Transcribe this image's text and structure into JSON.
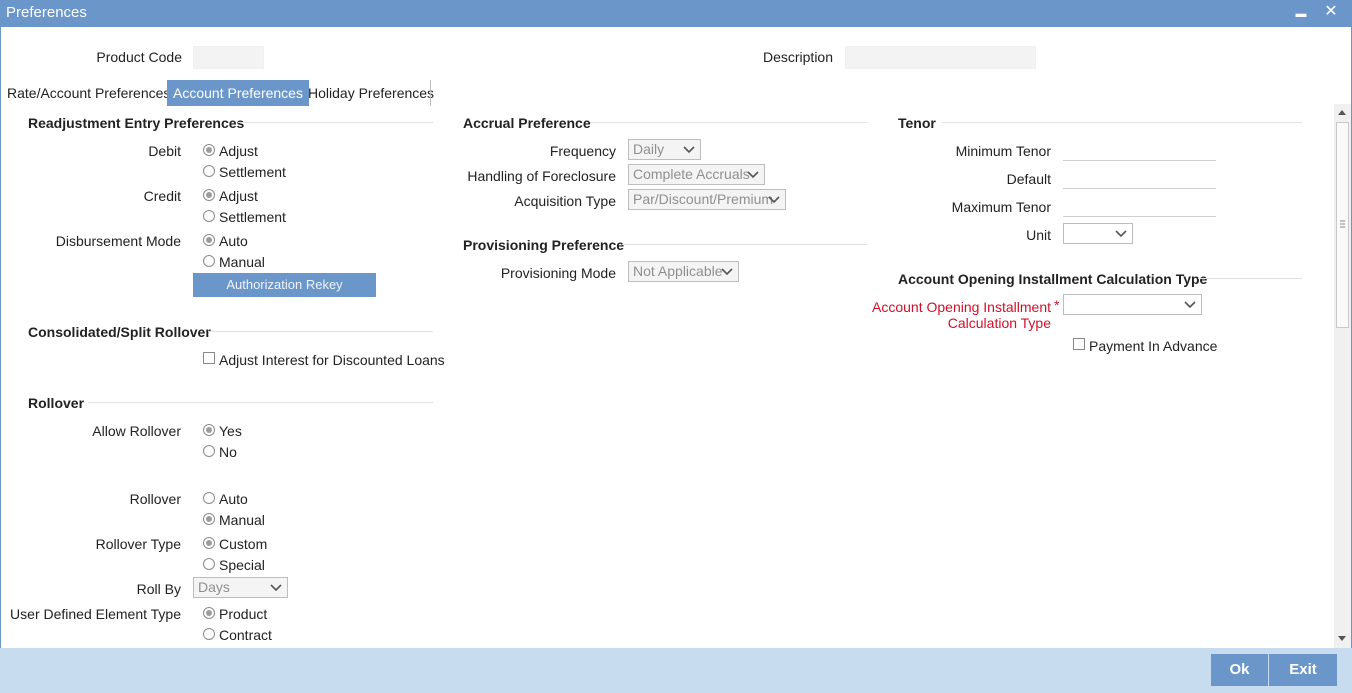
{
  "window": {
    "title": "Preferences",
    "minimize": "▬",
    "close": "✕"
  },
  "header": {
    "product_code_label": "Product Code",
    "description_label": "Description"
  },
  "tabs": [
    {
      "label": "Rate/Account Preferences",
      "active": false
    },
    {
      "label": "Account Preferences",
      "active": true
    },
    {
      "label": "Holiday Preferences",
      "active": false
    }
  ],
  "readjustment": {
    "title": "Readjustment Entry Preferences",
    "debit_label": "Debit",
    "debit_options": [
      "Adjust",
      "Settlement"
    ],
    "credit_label": "Credit",
    "credit_options": [
      "Adjust",
      "Settlement"
    ],
    "disbursement_label": "Disbursement Mode",
    "disbursement_options": [
      "Auto",
      "Manual"
    ],
    "auth_rekey_button": "Authorization Rekey"
  },
  "consolidated": {
    "title": "Consolidated/Split Rollover",
    "adjust_interest_label": "Adjust Interest for Discounted Loans"
  },
  "rollover": {
    "title": "Rollover",
    "allow_label": "Allow Rollover",
    "allow_options": [
      "Yes",
      "No"
    ],
    "rollover_label": "Rollover",
    "rollover_options": [
      "Auto",
      "Manual"
    ],
    "type_label": "Rollover Type",
    "type_options": [
      "Custom",
      "Special"
    ],
    "roll_by_label": "Roll By",
    "roll_by_value": "Days",
    "ude_label": "User Defined Element Type",
    "ude_options": [
      "Product",
      "Contract"
    ]
  },
  "accrual": {
    "title": "Accrual Preference",
    "frequency_label": "Frequency",
    "frequency_value": "Daily",
    "foreclosure_label": "Handling of Foreclosure",
    "foreclosure_value": "Complete Accruals",
    "acquisition_label": "Acquisition Type",
    "acquisition_value": "Par/Discount/Premium"
  },
  "provisioning": {
    "title": "Provisioning Preference",
    "mode_label": "Provisioning Mode",
    "mode_value": "Not Applicable"
  },
  "tenor": {
    "title": "Tenor",
    "min_label": "Minimum Tenor",
    "default_label": "Default",
    "max_label": "Maximum Tenor",
    "unit_label": "Unit"
  },
  "installment": {
    "title": "Account Opening Installment Calculation Type",
    "calc_label_line1": "Account Opening Installment",
    "calc_label_line2": "Calculation Type",
    "required_mark": "*",
    "payment_advance_label": "Payment In Advance"
  },
  "footer": {
    "ok": "Ok",
    "exit": "Exit"
  },
  "colors": {
    "accent": "#6a96c9",
    "footer_bg": "#c8dcef",
    "required": "#d1112a"
  }
}
